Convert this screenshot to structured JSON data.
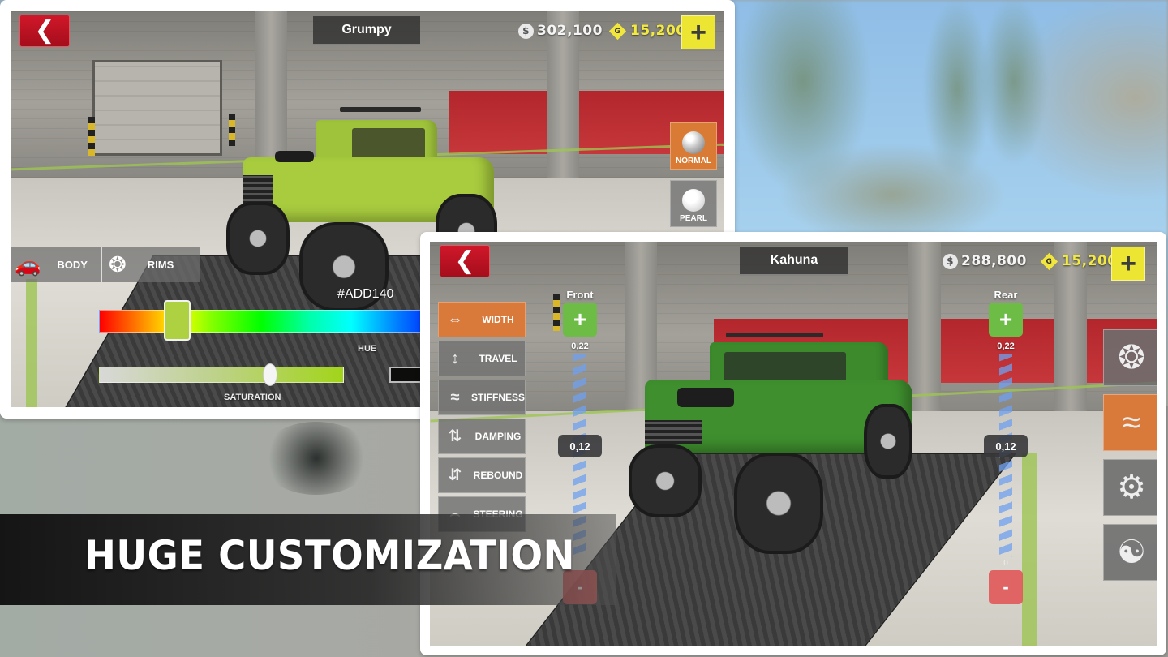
{
  "banner": {
    "text": "HUGE CUSTOMIZATION"
  },
  "screen_paint": {
    "vehicle_name": "Grumpy",
    "back_icon": "chevron-left-icon",
    "money": "302,100",
    "gold": "15,200",
    "money_icon": "$",
    "gold_icon": "G",
    "add_currency_label": "+",
    "finishes": [
      {
        "label": "NORMAL",
        "selected": true
      },
      {
        "label": "PEARL",
        "selected": false
      }
    ],
    "tabs": [
      {
        "label": "BODY",
        "icon": "car-spray-icon",
        "selected": true
      },
      {
        "label": "RIMS",
        "icon": "rim-icon",
        "selected": false
      }
    ],
    "color_hex": "#ADD140",
    "hue_label": "HUE",
    "hue_value_pct": 24,
    "saturation_label": "SATURATION",
    "saturation_value_pct": 70,
    "colors": {
      "accent_orange": "#D97B34",
      "back_red": "#C01224",
      "gold_yellow": "#ECE531",
      "paint": "#ADD140"
    }
  },
  "screen_suspension": {
    "vehicle_name": "Kahuna",
    "back_icon": "chevron-left-icon",
    "money": "288,800",
    "gold": "15,200",
    "money_icon": "$",
    "gold_icon": "G",
    "add_currency_label": "+",
    "menu": [
      {
        "label": "WIDTH",
        "icon": "axle-width-icon",
        "selected": true
      },
      {
        "label": "TRAVEL",
        "icon": "shock-travel-icon",
        "selected": false
      },
      {
        "label": "STIFFNESS",
        "icon": "spring-icon",
        "selected": false
      },
      {
        "label": "DAMPING",
        "icon": "damper-icon",
        "selected": false
      },
      {
        "label": "REBOUND",
        "icon": "rebound-icon",
        "selected": false
      },
      {
        "label": "STEERING",
        "icon": "steering-icon",
        "selected": false
      }
    ],
    "front": {
      "title": "Front",
      "max": "0,22",
      "value": "0,12",
      "min": "",
      "plus": "+",
      "minus": "-"
    },
    "rear": {
      "title": "Rear",
      "max": "0,22",
      "value": "0,12",
      "min": "0",
      "plus": "+",
      "minus": "-"
    },
    "categories": [
      {
        "name": "wheels",
        "icon": "wheel-icon",
        "selected": false
      },
      {
        "name": "suspension",
        "icon": "shock-absorber-icon",
        "selected": true
      },
      {
        "name": "transmission",
        "icon": "gearbox-icon",
        "selected": false
      },
      {
        "name": "transfer-case",
        "icon": "chain-drive-icon",
        "selected": false
      }
    ]
  }
}
